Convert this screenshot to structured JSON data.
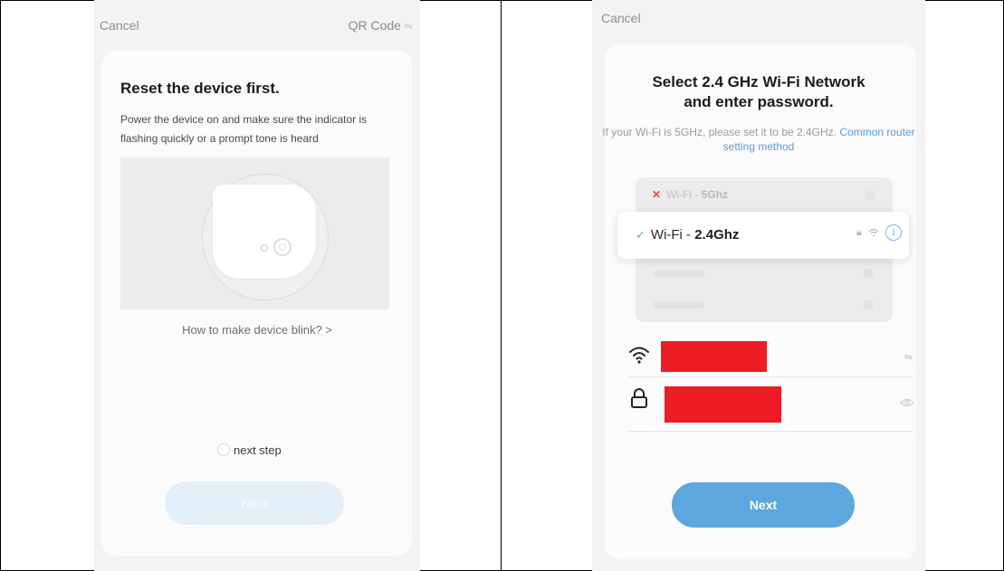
{
  "screen1": {
    "cancel_label": "Cancel",
    "qr_label": "QR Code",
    "title": "Reset the device first.",
    "description": "Power the device on and make sure the indicator is flashing quickly or a prompt tone is heard",
    "blink_link": "How to make device blink? >",
    "next_step_label": "next step",
    "next_button": "Next",
    "next_button_enabled": false,
    "next_step_checked": false
  },
  "screen2": {
    "cancel_label": "Cancel",
    "title_line1": "Select 2.4 GHz Wi-Fi Network",
    "title_line2": "and enter password.",
    "desc_prefix": "If your Wi-Fi is 5GHz, please set it to be 2.4GHz.",
    "desc_link": "Common router setting method",
    "networks": [
      {
        "prefix": "Wi-Fi - ",
        "band": "5Ghz",
        "status": "unsupported"
      },
      {
        "prefix": "Wi-Fi - ",
        "band": "2.4Ghz",
        "status": "selected"
      }
    ],
    "next_button": "Next"
  },
  "colors": {
    "accent": "#5ca8de",
    "check": "#53b487",
    "error": "#e44444",
    "redaction": "#ee1c24"
  },
  "icons": [
    "qr-code-icon",
    "check-icon",
    "x-icon",
    "lock-icon",
    "wifi-icon",
    "info-icon",
    "swap-icon",
    "eye-icon"
  ]
}
